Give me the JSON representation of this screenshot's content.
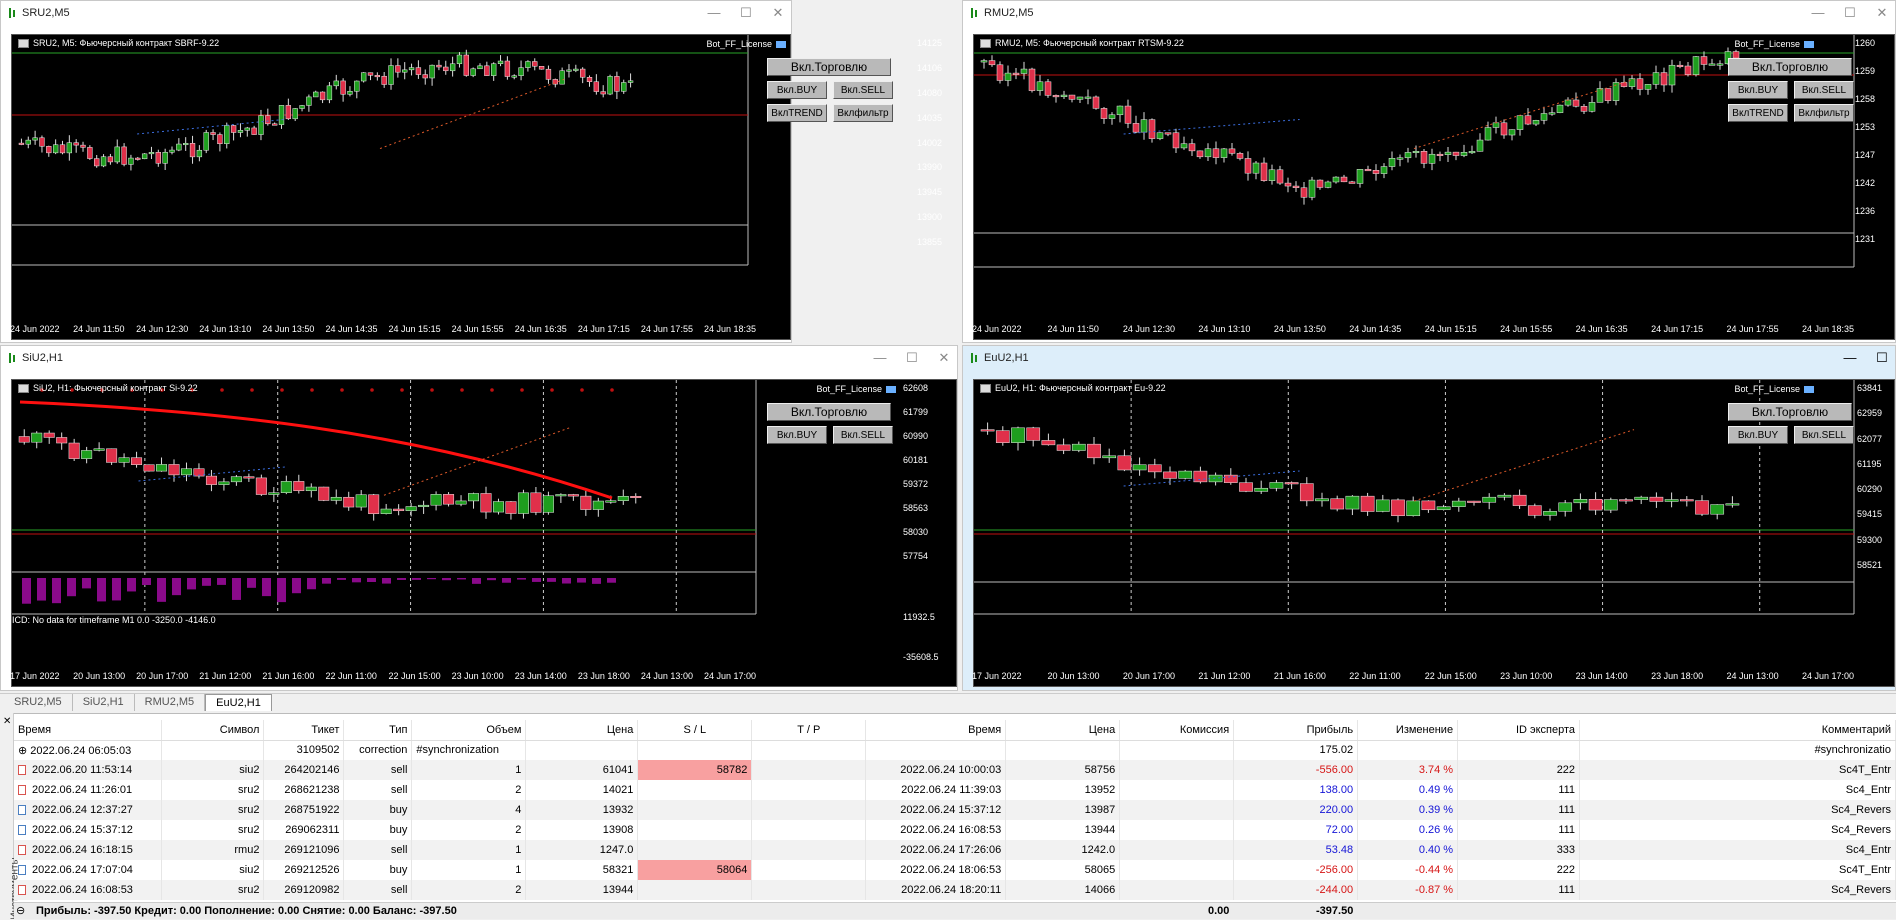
{
  "windows": [
    {
      "title": "SRU2,M5",
      "label": "SRU2, M5:  Фьючерсный контракт SBRF-9.22",
      "license": "Bot_FF_License",
      "prices": [
        "14125",
        "14106",
        "14080",
        "14035",
        "14002",
        "13990",
        "13945",
        "13900",
        "13855"
      ],
      "xlabels": [
        "24 Jun 2022",
        "24 Jun 11:50",
        "24 Jun 12:30",
        "24 Jun 13:10",
        "24 Jun 13:50",
        "24 Jun 14:35",
        "24 Jun 15:15",
        "24 Jun 15:55",
        "24 Jun 16:35",
        "24 Jun 17:15",
        "24 Jun 17:55",
        "24 Jun 18:35"
      ]
    },
    {
      "title": "RMU2,M5",
      "label": "RMU2, M5:  Фьючерсный контракт RTSM-9.22",
      "license": "Bot_FF_License",
      "prices": [
        "1260",
        "1259",
        "1258",
        "1253",
        "1247",
        "1242",
        "1236",
        "1231"
      ],
      "xlabels": [
        "24 Jun 2022",
        "24 Jun 11:50",
        "24 Jun 12:30",
        "24 Jun 13:10",
        "24 Jun 13:50",
        "24 Jun 14:35",
        "24 Jun 15:15",
        "24 Jun 15:55",
        "24 Jun 16:35",
        "24 Jun 17:15",
        "24 Jun 17:55",
        "24 Jun 18:35"
      ]
    },
    {
      "title": "SiU2,H1",
      "label": "SiU2, H1:  Фьючерсный контракт Si-9.22",
      "license": "Bot_FF_License",
      "prices": [
        "62608",
        "61799",
        "60990",
        "60181",
        "59372",
        "58563",
        "58030",
        "57754"
      ],
      "sub_label": "ICD: No data for timeframe M1 0.0 -3250.0 -4146.0",
      "sub_prices": [
        "11932.5",
        "-35608.5"
      ],
      "xlabels": [
        "17 Jun 2022",
        "20 Jun 13:00",
        "20 Jun 17:00",
        "21 Jun 12:00",
        "21 Jun 16:00",
        "22 Jun 11:00",
        "22 Jun 15:00",
        "23 Jun 10:00",
        "23 Jun 14:00",
        "23 Jun 18:00",
        "24 Jun 13:00",
        "24 Jun 17:00"
      ]
    },
    {
      "title": "EuU2,H1",
      "label": "EuU2, H1:  Фьючерсный контракт Eu-9.22",
      "license": "Bot_FF_License",
      "prices": [
        "63841",
        "62959",
        "62077",
        "61195",
        "60290",
        "59415",
        "59300",
        "58521"
      ],
      "xlabels": [
        "17 Jun 2022",
        "20 Jun 13:00",
        "20 Jun 17:00",
        "21 Jun 12:00",
        "21 Jun 16:00",
        "22 Jun 11:00",
        "22 Jun 15:00",
        "23 Jun 10:00",
        "23 Jun 14:00",
        "23 Jun 18:00",
        "24 Jun 13:00",
        "24 Jun 17:00"
      ]
    }
  ],
  "buttons": {
    "trade": "Вкл.Торговлю",
    "buy": "Вкл.BUY",
    "sell": "Вкл.SELL",
    "trend": "ВклTREND",
    "filter": "Вклфильтр"
  },
  "tabs": [
    "SRU2,M5",
    "SiU2,H1",
    "RMU2,M5",
    "EuU2,H1"
  ],
  "side_label": "Инструменты",
  "table": {
    "headers": [
      "Время",
      "Символ",
      "Тикет",
      "Тип",
      "Объем",
      "Цена",
      "S / L",
      "T / P",
      "Время",
      "Цена",
      "Комиссия",
      "Прибыль",
      "Изменение",
      "ID эксперта",
      "Комментарий"
    ],
    "balance_row": {
      "time": "2022.06.24 06:05:03",
      "ticket": "3109502",
      "type": "correction",
      "comment": "#synchronization",
      "profit": "175.02",
      "comment2": "#synchronizatio"
    },
    "rows": [
      {
        "time": "2022.06.20 11:53:14",
        "sym": "siu2",
        "ticket": "264202146",
        "type": "sell",
        "vol": "1",
        "price": "61041",
        "sl": "58782",
        "tp": "",
        "ctime": "2022.06.24 10:00:03",
        "cprice": "58756",
        "comm": "",
        "profit": "-556.00",
        "change": "3.74 %",
        "id": "222",
        "comment": "Sc4T_Entr",
        "pcolor": "red",
        "ccolor": "red"
      },
      {
        "time": "2022.06.24 11:26:01",
        "sym": "sru2",
        "ticket": "268621238",
        "type": "sell",
        "vol": "2",
        "price": "14021",
        "sl": "",
        "tp": "",
        "ctime": "2022.06.24 11:39:03",
        "cprice": "13952",
        "comm": "",
        "profit": "138.00",
        "change": "0.49 %",
        "id": "111",
        "comment": "Sc4_Entr",
        "pcolor": "blue",
        "ccolor": "blue"
      },
      {
        "time": "2022.06.24 12:37:27",
        "sym": "sru2",
        "ticket": "268751922",
        "type": "buy",
        "vol": "4",
        "price": "13932",
        "sl": "",
        "tp": "",
        "ctime": "2022.06.24 15:37:12",
        "cprice": "13987",
        "comm": "",
        "profit": "220.00",
        "change": "0.39 %",
        "id": "111",
        "comment": "Sc4_Revers",
        "pcolor": "blue",
        "ccolor": "blue"
      },
      {
        "time": "2022.06.24 15:37:12",
        "sym": "sru2",
        "ticket": "269062311",
        "type": "buy",
        "vol": "2",
        "price": "13908",
        "sl": "",
        "tp": "",
        "ctime": "2022.06.24 16:08:53",
        "cprice": "13944",
        "comm": "",
        "profit": "72.00",
        "change": "0.26 %",
        "id": "111",
        "comment": "Sc4_Revers",
        "pcolor": "blue",
        "ccolor": "blue"
      },
      {
        "time": "2022.06.24 16:18:15",
        "sym": "rmu2",
        "ticket": "269121096",
        "type": "sell",
        "vol": "1",
        "price": "1247.0",
        "sl": "",
        "tp": "",
        "ctime": "2022.06.24 17:26:06",
        "cprice": "1242.0",
        "comm": "",
        "profit": "53.48",
        "change": "0.40 %",
        "id": "333",
        "comment": "Sc4_Entr",
        "pcolor": "blue",
        "ccolor": "blue"
      },
      {
        "time": "2022.06.24 17:07:04",
        "sym": "siu2",
        "ticket": "269212526",
        "type": "buy",
        "vol": "1",
        "price": "58321",
        "sl": "58064",
        "tp": "",
        "ctime": "2022.06.24 18:06:53",
        "cprice": "58065",
        "comm": "",
        "profit": "-256.00",
        "change": "-0.44 %",
        "id": "222",
        "comment": "Sc4T_Entr",
        "pcolor": "red",
        "ccolor": "red"
      },
      {
        "time": "2022.06.24 16:08:53",
        "sym": "sru2",
        "ticket": "269120982",
        "type": "sell",
        "vol": "2",
        "price": "13944",
        "sl": "",
        "tp": "",
        "ctime": "2022.06.24 18:20:11",
        "cprice": "14066",
        "comm": "",
        "profit": "-244.00",
        "change": "-0.87 %",
        "id": "111",
        "comment": "Sc4_Revers",
        "pcolor": "red",
        "ccolor": "red"
      }
    ],
    "footer": "Прибыль: -397.50  Кредит: 0.00  Пополнение: 0.00  Снятие: 0.00  Баланс: -397.50",
    "footer_comm": "0.00",
    "footer_profit": "-397.50"
  }
}
